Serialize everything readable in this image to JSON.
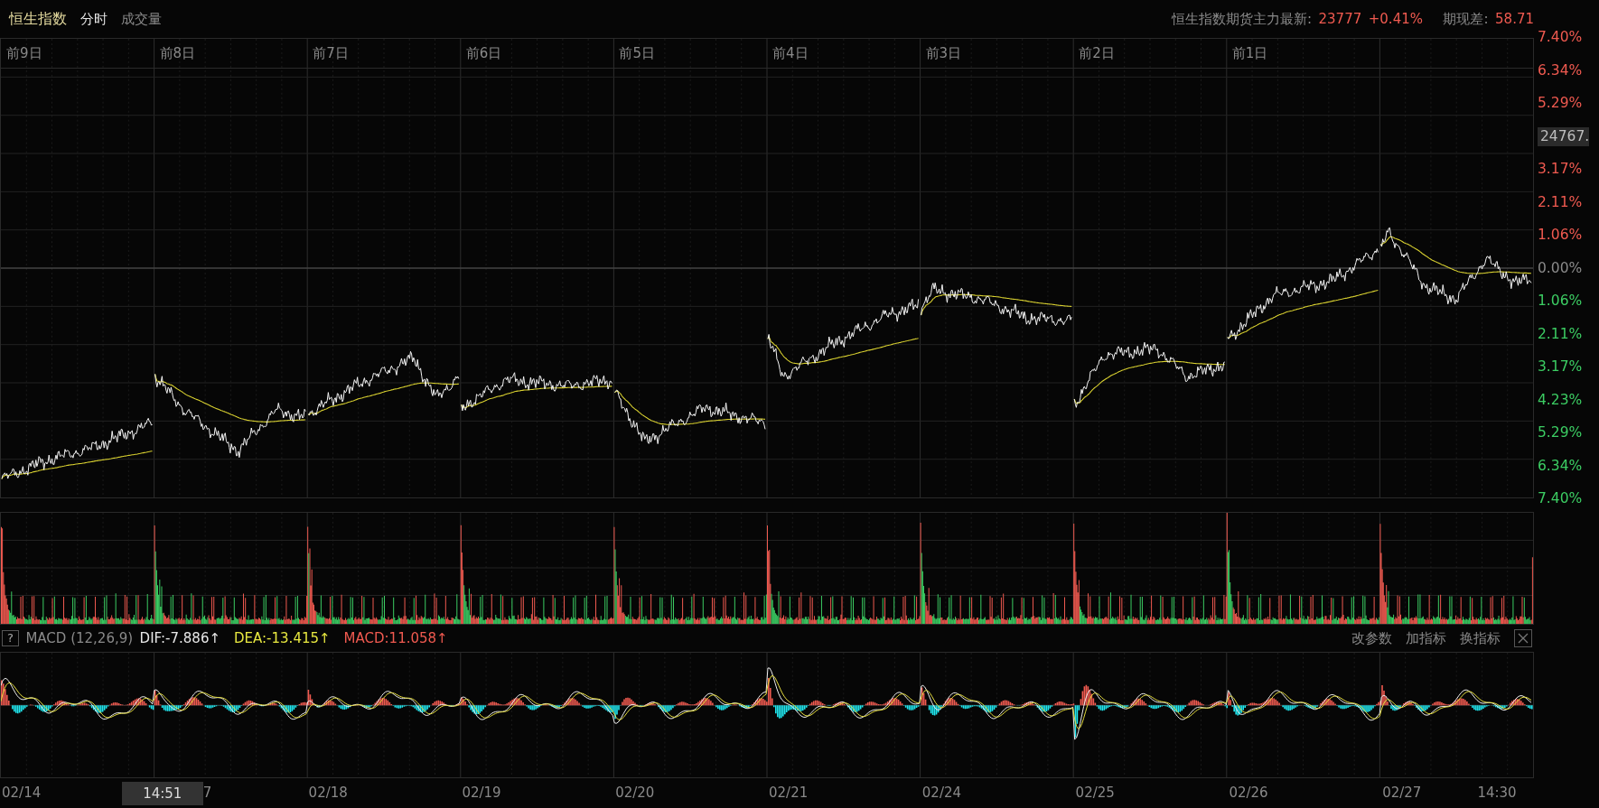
{
  "header": {
    "title": "恒生指数",
    "tabs": [
      {
        "label": "分时"
      },
      {
        "label": "成交量"
      }
    ],
    "futures": {
      "label": "恒生指数期货主力最新:",
      "price": "23777",
      "change": "+0.41%",
      "spread_label": "期现差:",
      "spread": "58.71"
    }
  },
  "day_labels": [
    "前9日",
    "前8日",
    "前7日",
    "前6日",
    "前5日",
    "前4日",
    "前3日",
    "前2日",
    "前1日"
  ],
  "y_axis": [
    {
      "label": "7.40%",
      "kind": "up"
    },
    {
      "label": "6.34%",
      "kind": "up"
    },
    {
      "label": "5.29%",
      "kind": "up"
    },
    {
      "label": "24767.",
      "kind": "tag"
    },
    {
      "label": "3.17%",
      "kind": "up"
    },
    {
      "label": "2.11%",
      "kind": "up"
    },
    {
      "label": "1.06%",
      "kind": "up"
    },
    {
      "label": "0.00%",
      "kind": "flat"
    },
    {
      "label": "1.06%",
      "kind": "down"
    },
    {
      "label": "2.11%",
      "kind": "down"
    },
    {
      "label": "3.17%",
      "kind": "down"
    },
    {
      "label": "4.23%",
      "kind": "down"
    },
    {
      "label": "5.29%",
      "kind": "down"
    },
    {
      "label": "6.34%",
      "kind": "down"
    },
    {
      "label": "7.40%",
      "kind": "down"
    }
  ],
  "macd": {
    "help": "?",
    "name": "MACD (12,26,9)",
    "dif": "DIF:-7.886↑",
    "dea": "DEA:-13.415↑",
    "value": "MACD:11.058↑",
    "actions": [
      "改参数",
      "加指标",
      "换指标"
    ]
  },
  "x_axis": [
    [
      {
        "kind": "date",
        "label": "02/14"
      }
    ],
    [
      {
        "kind": "cursor",
        "label": "14:51"
      },
      {
        "kind": "date",
        "label": "7"
      }
    ],
    [
      {
        "kind": "date",
        "label": "02/18"
      }
    ],
    [
      {
        "kind": "date",
        "label": "02/19"
      }
    ],
    [
      {
        "kind": "date",
        "label": "02/20"
      }
    ],
    [
      {
        "kind": "date",
        "label": "02/21"
      }
    ],
    [
      {
        "kind": "date",
        "label": "02/24"
      }
    ],
    [
      {
        "kind": "date",
        "label": "02/25"
      }
    ],
    [
      {
        "kind": "date",
        "label": "02/26"
      }
    ],
    [
      {
        "kind": "date",
        "label": "02/27"
      },
      {
        "kind": "time",
        "label": "14:30"
      }
    ]
  ]
}
